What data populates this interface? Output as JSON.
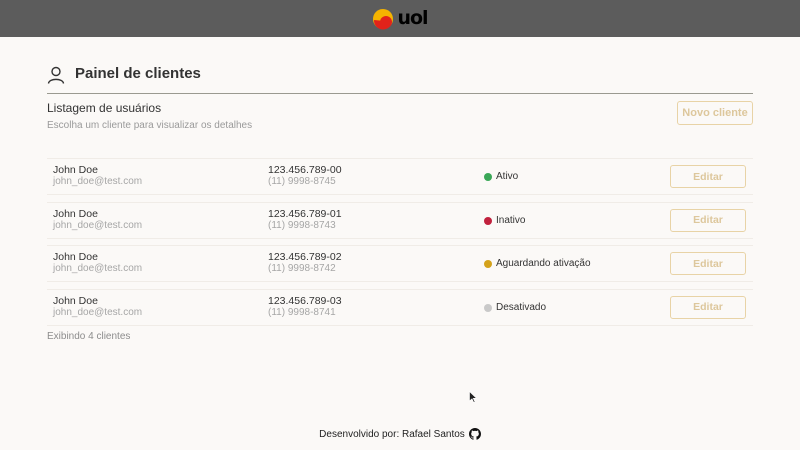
{
  "topbar": {
    "logo_text": "uol",
    "logo_icon": "uol-ball-logo",
    "colors": {
      "bar": "#5c5c5c",
      "logo_yellow": "#f5b400",
      "logo_red": "#e2231a"
    }
  },
  "panel": {
    "icon": "user-icon",
    "title": "Painel de clientes"
  },
  "list": {
    "heading": "Listagem de usuários",
    "subheading": "Escolha um cliente para visualizar os detalhes",
    "new_button_label": "Novo cliente",
    "edit_label": "Editar",
    "count_text": "Exibindo 4 clientes"
  },
  "clients": [
    {
      "name": "John Doe",
      "email": "john_doe@test.com",
      "cpf": "123.456.789-00",
      "phone": "(11) 9998-8745",
      "status": "Ativo",
      "status_color": "#3aa757"
    },
    {
      "name": "John Doe",
      "email": "john_doe@test.com",
      "cpf": "123.456.789-01",
      "phone": "(11) 9998-8743",
      "status": "Inativo",
      "status_color": "#c1213d"
    },
    {
      "name": "John Doe",
      "email": "john_doe@test.com",
      "cpf": "123.456.789-02",
      "phone": "(11) 9998-8742",
      "status": "Aguardando ativação",
      "status_color": "#d4a21b"
    },
    {
      "name": "John Doe",
      "email": "john_doe@test.com",
      "cpf": "123.456.789-03",
      "phone": "(11) 9998-8741",
      "status": "Desativado",
      "status_color": "#c9c9c9"
    }
  ],
  "footer": {
    "text": "Desenvolvido por: Rafael Santos",
    "icon": "github-icon"
  },
  "accent_colors": {
    "button_border": "#e8d3a6",
    "button_text": "#ddc79c",
    "background": "#fbf9f7"
  }
}
